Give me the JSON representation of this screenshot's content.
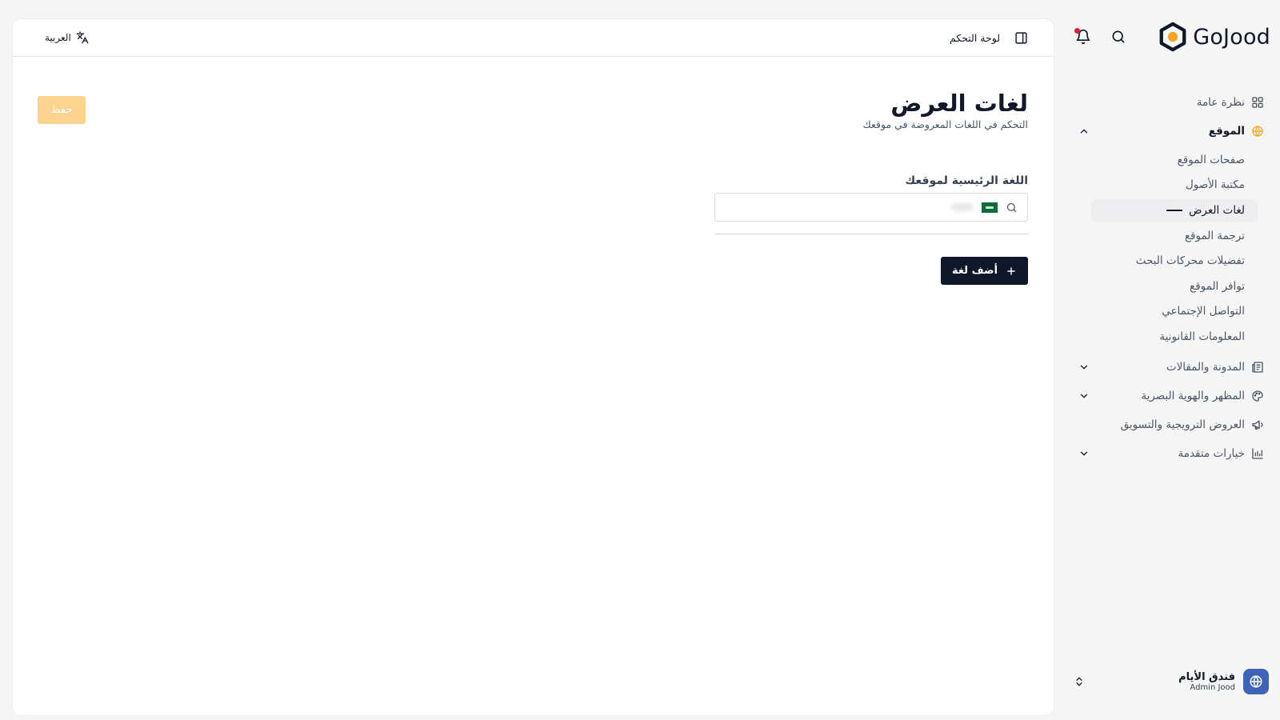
{
  "brand": {
    "name": "GoJood",
    "accent": "#f5a524"
  },
  "topbar": {
    "title": "لوحة التحكم",
    "language_label": "العربية"
  },
  "sidebar": {
    "items": [
      {
        "label": "نظرة عامة",
        "icon": "grid-icon"
      },
      {
        "label": "الموقع",
        "icon": "globe-icon",
        "expanded": true,
        "children": [
          "صفحات الموقع",
          "مكتبة الأصول",
          "لغات العرض",
          "ترجمة الموقع",
          "تفضيلات محركات البحث",
          "توافر الموقع",
          "التواصل الإجتماعي",
          "المعلومات القانونية"
        ]
      },
      {
        "label": "المدونة والمقالات",
        "icon": "newspaper-icon",
        "expanded": false
      },
      {
        "label": "المظهر والهوية البصرية",
        "icon": "palette-icon",
        "expanded": false
      },
      {
        "label": "العروض الترويجية والتسويق",
        "icon": "megaphone-icon"
      },
      {
        "label": "خيارات متقدمة",
        "icon": "bar-chart-icon",
        "expanded": false
      }
    ]
  },
  "account": {
    "name": "فندق الأيام",
    "subtitle": "Admin Jood"
  },
  "page": {
    "title": "لغات العرض",
    "subtitle": "التحكم في اللغات المعروضة في موقعك",
    "save_label": "حفظ",
    "primary_language_label": "اللغة الرئيسية لموقعك",
    "add_language_label": "أضف لغة"
  },
  "colors": {
    "primary": "#0f172a",
    "save_disabled": "#fbd38d",
    "notification": "#e11d2e",
    "avatar": "#3f63b8"
  }
}
